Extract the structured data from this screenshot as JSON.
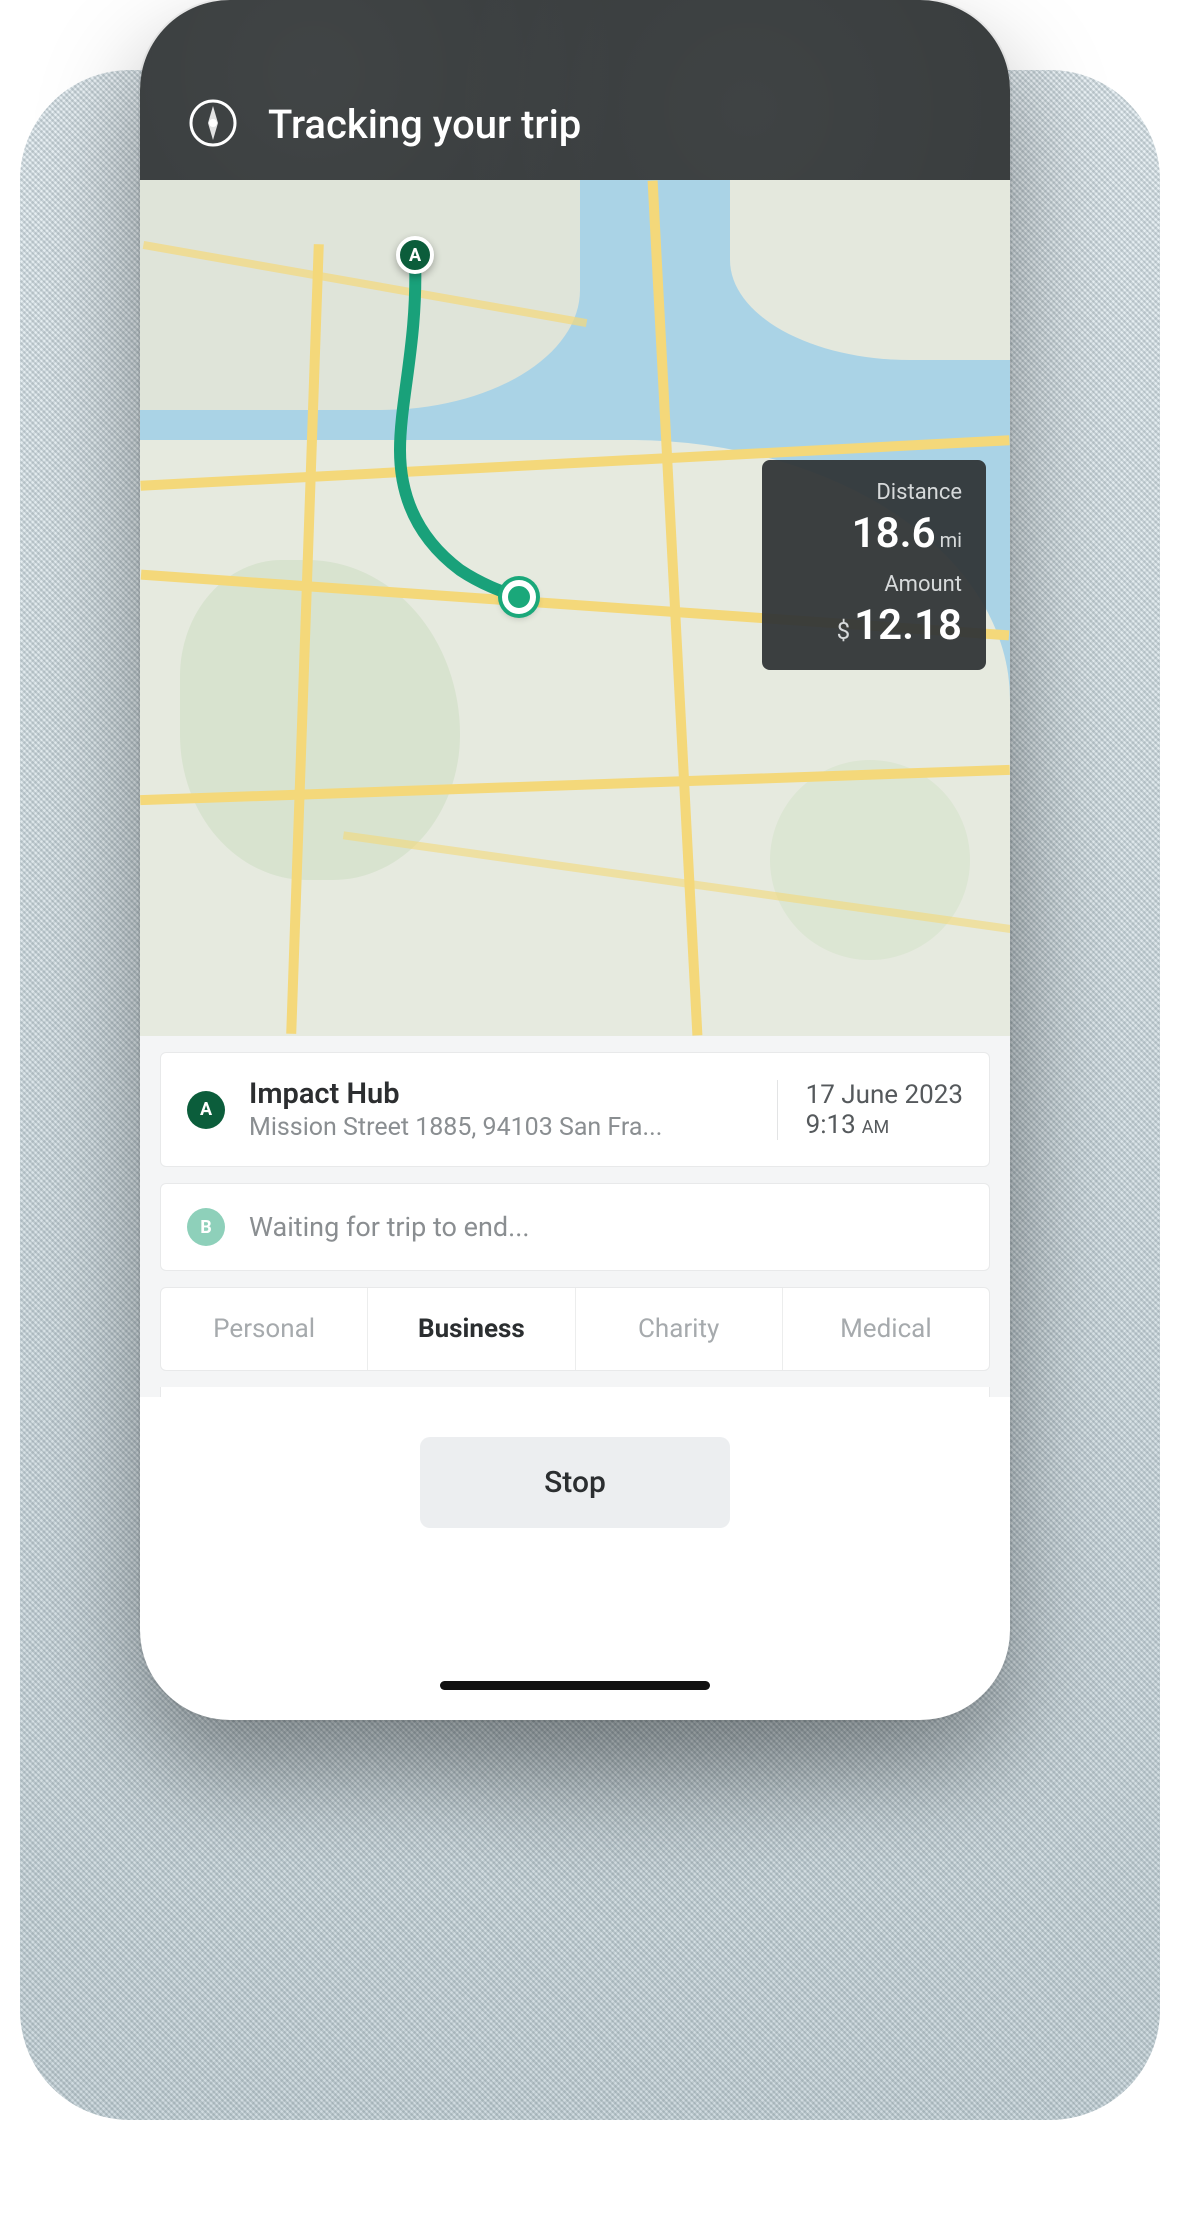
{
  "header": {
    "title": "Tracking your trip"
  },
  "overlay": {
    "distance_label": "Distance",
    "distance_value": "18.6",
    "distance_unit": "mi",
    "amount_label": "Amount",
    "amount_prefix": "$",
    "amount_value": "12.18"
  },
  "origin": {
    "pin": "A",
    "name": "Impact Hub",
    "address": "Mission Street 1885, 94103 San Fra...",
    "date": "17 June 2023",
    "time": "9:13",
    "time_suffix": "AM"
  },
  "destination": {
    "pin": "B",
    "status": "Waiting for trip to end..."
  },
  "categories": {
    "items": [
      "Personal",
      "Business",
      "Charity",
      "Medical"
    ],
    "active": "Business"
  },
  "actions": {
    "stop": "Stop"
  },
  "colors": {
    "route": "#19a17a",
    "pin_primary": "#0b5d3b",
    "pin_secondary": "#8ed0ba",
    "header_bg": "#2a2d2f"
  }
}
